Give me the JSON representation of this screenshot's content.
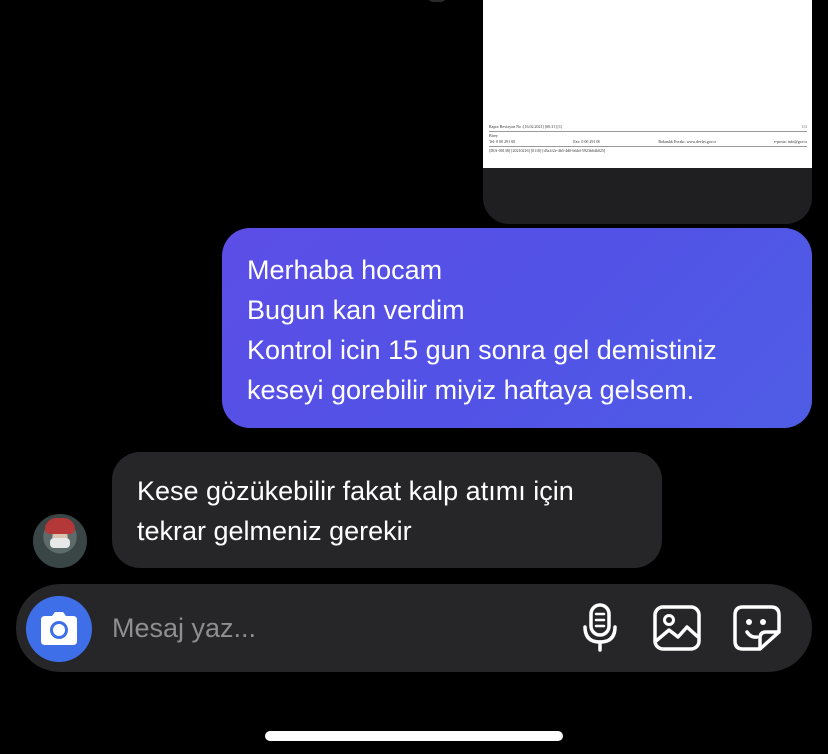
{
  "image_message": {
    "footer": {
      "line1_left": "Rapor Revizyon No :",
      "line1_mid": "[16.02.2021] [00:31] [1]",
      "line1_right": "1/1",
      "line2": "Birey",
      "line3_a": "Tel: 0 00 291 00",
      "line3_b": "Fax: 0 00 291 00",
      "line3_c": "Bakanlık Evrakı: www.devlet.gov.tr",
      "line3_d": "e-posta: info@gov.tr",
      "line4": "[DIA-00138] [20210216] [0110] [d3a1f2e-4b5-4d0-b64d-5923b64b025]"
    }
  },
  "outgoing_message": {
    "lines": [
      "Merhaba hocam",
      "Bugun kan verdim",
      "Kontrol icin 15 gun sonra gel demistiniz",
      "keseyi gorebilir miyiz haftaya gelsem."
    ]
  },
  "incoming_message": {
    "lines": [
      "Kese gözükebilir fakat kalp atımı için",
      "tekrar gelmeniz gerekir"
    ]
  },
  "composer": {
    "placeholder": "Mesaj yaz...",
    "value": ""
  },
  "icons": {
    "camera": "camera-icon",
    "mic": "microphone-icon",
    "gallery": "gallery-icon",
    "sticker": "sticker-icon"
  },
  "colors": {
    "background": "#000000",
    "outgoing_bubble": "#5452e6",
    "incoming_bubble": "#262628",
    "camera_button": "#3f6fe8",
    "placeholder": "#8e8e93"
  }
}
